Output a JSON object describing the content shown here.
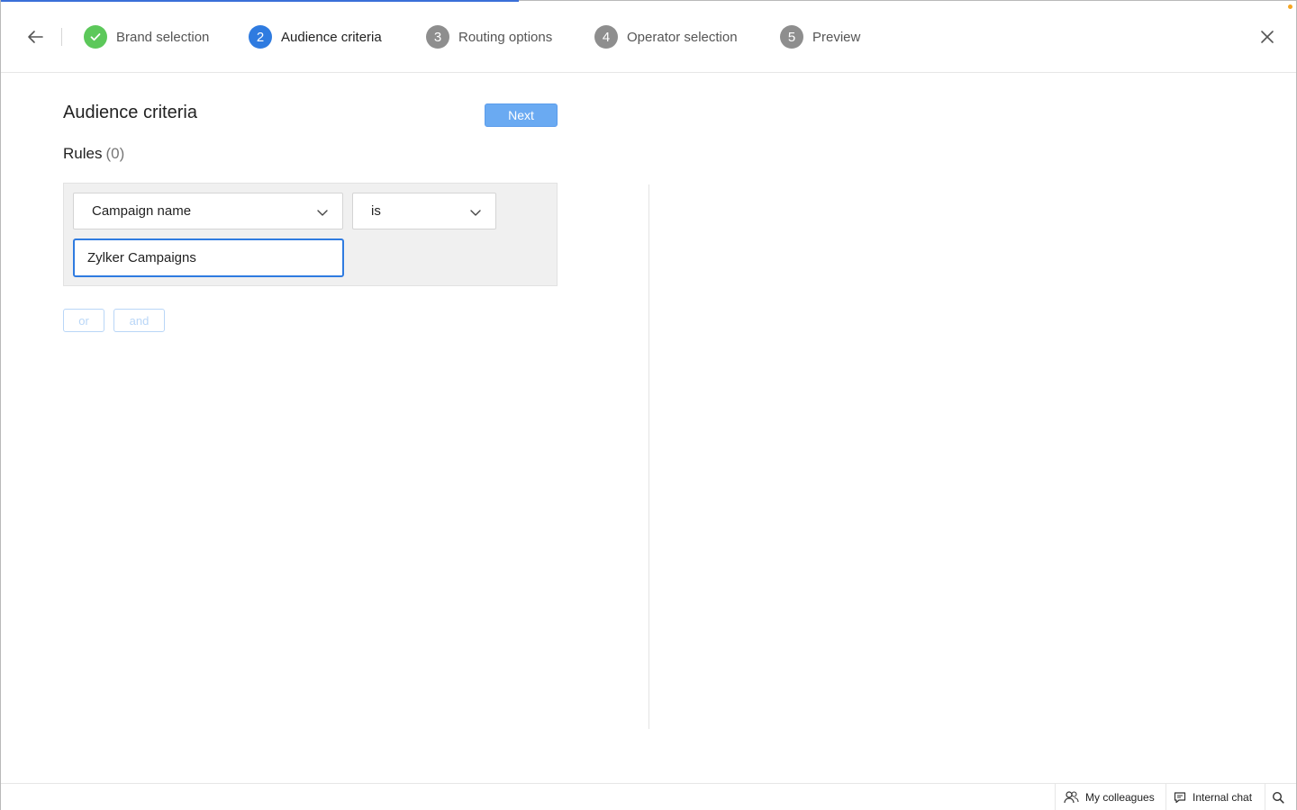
{
  "header": {
    "back_icon": "arrow-left-icon",
    "close_icon": "close-icon",
    "steps": [
      {
        "number": "",
        "label": "Brand selection",
        "state": "done",
        "icon": "check-icon"
      },
      {
        "number": "2",
        "label": "Audience criteria",
        "state": "active"
      },
      {
        "number": "3",
        "label": "Routing options",
        "state": "pending"
      },
      {
        "number": "4",
        "label": "Operator selection",
        "state": "pending"
      },
      {
        "number": "5",
        "label": "Preview",
        "state": "pending"
      }
    ]
  },
  "main": {
    "title": "Audience criteria",
    "next_label": "Next",
    "rules_label": "Rules",
    "rules_count": "(0)",
    "rule": {
      "field": "Campaign name",
      "operator": "is",
      "value": "Zylker Campaigns"
    },
    "or_label": "or",
    "and_label": "and"
  },
  "footer": {
    "colleagues_label": "My colleagues",
    "chat_label": "Internal chat",
    "search_icon": "search-icon"
  },
  "colors": {
    "accent": "#2f7be0",
    "done": "#5cc85a",
    "pending": "#8e8e8e",
    "next_button": "#6aaaf2"
  }
}
